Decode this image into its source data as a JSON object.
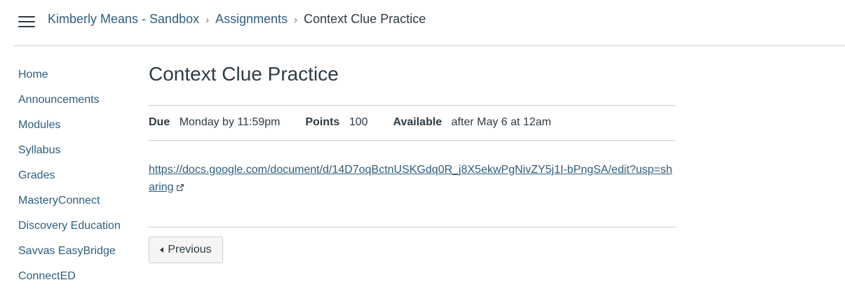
{
  "breadcrumb": {
    "course": "Kimberly Means - Sandbox",
    "section": "Assignments",
    "current": "Context Clue Practice",
    "separator": "›"
  },
  "sidebar": {
    "items": [
      {
        "label": "Home"
      },
      {
        "label": "Announcements"
      },
      {
        "label": "Modules"
      },
      {
        "label": "Syllabus"
      },
      {
        "label": "Grades"
      },
      {
        "label": "MasteryConnect"
      },
      {
        "label": "Discovery Education"
      },
      {
        "label": "Savvas EasyBridge"
      },
      {
        "label": "ConnectED"
      }
    ]
  },
  "assignment": {
    "title": "Context Clue Practice",
    "due_label": "Due",
    "due_value": "Monday by 11:59pm",
    "points_label": "Points",
    "points_value": "100",
    "available_label": "Available",
    "available_value": "after May 6 at 12am",
    "link_text": "https://docs.google.com/document/d/14D7oqBctnUSKGdq0R_j8X5ekwPgNivZY5j1I-bPngSA/edit?usp=sharing"
  },
  "navigation": {
    "previous_label": "Previous"
  },
  "colors": {
    "link": "#2d5e80",
    "text": "#2d3b45",
    "divider": "#c7cdd1",
    "button_bg": "#f5f5f5"
  },
  "icons": {
    "menu": "hamburger-menu-icon",
    "external_link": "external-link-icon",
    "previous": "caret-left-icon"
  }
}
